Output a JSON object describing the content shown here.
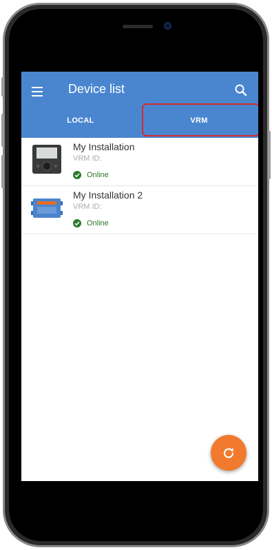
{
  "header": {
    "title": "Device list"
  },
  "tabs": [
    {
      "label": "LOCAL"
    },
    {
      "label": "VRM",
      "selected": true
    }
  ],
  "devices": [
    {
      "name": "My Installation",
      "vrm_id": "VRM ID:",
      "status": "Online",
      "icon": "gx-display-device-icon"
    },
    {
      "name": "My Installation 2",
      "vrm_id": "VRM ID:",
      "status": "Online",
      "icon": "inverter-device-icon"
    }
  ],
  "fab": {
    "icon": "refresh-icon"
  },
  "colors": {
    "appbar": "#4a86d0",
    "highlight": "#d42b2b",
    "fab": "#f27a2e",
    "online": "#2a7a2a"
  }
}
